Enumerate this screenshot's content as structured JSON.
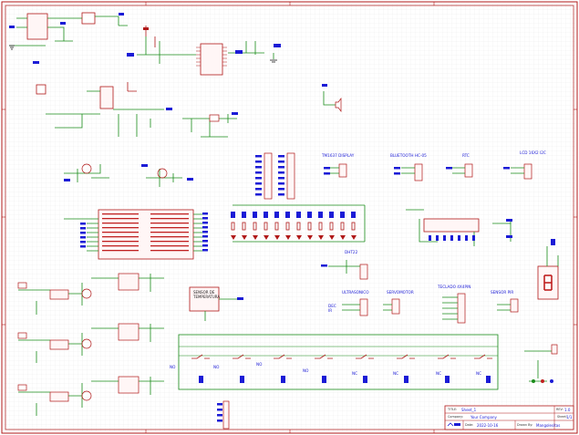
{
  "sheet": {
    "title_block": {
      "title_label": "TITLE:",
      "title_value": "Sheet_1",
      "rev_label": "REV:",
      "rev_value": "1.0",
      "company_label": "Company:",
      "company_value": "Your Company",
      "date_label": "Date:",
      "date_value": "2022-10-16",
      "drawn_label": "Drawn By:",
      "drawn_value": "Mangolesitas",
      "sheet_label": "Sheet:",
      "sheet_value": "1/1"
    },
    "module_titles": {
      "tm1637": "TM1637 DISPLAY",
      "bluetooth": "BLUETOOTH HC-05",
      "rtc": "RTC",
      "lcd": "LCD 16X2 I2C",
      "dht22": "DHT22",
      "ultrasonic": "ULTRASONICO",
      "servo": "SERVOMOTOR",
      "keypad": "TECLADO 4X4PIN",
      "pir": "SENSOR PIR",
      "temp_sensor": "SENSOR DE TEMPERATURA",
      "dec_ir": "DEC",
      "ir_label": "IR",
      "no_labels": [
        "NO",
        "NO",
        "NO",
        "NO",
        "NC",
        "NC",
        "NC",
        "NC"
      ]
    }
  }
}
